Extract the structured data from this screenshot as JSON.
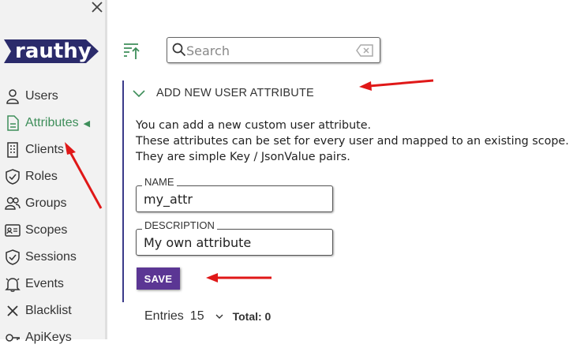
{
  "sidebar": {
    "logo_text": "rauthy",
    "close_icon": "close-icon",
    "items": [
      {
        "label": "Users",
        "icon": "user-icon"
      },
      {
        "label": "Attributes",
        "icon": "document-icon",
        "active": true
      },
      {
        "label": "Clients",
        "icon": "building-icon"
      },
      {
        "label": "Roles",
        "icon": "shield-check-icon"
      },
      {
        "label": "Groups",
        "icon": "users-group-icon"
      },
      {
        "label": "Scopes",
        "icon": "id-card-icon"
      },
      {
        "label": "Sessions",
        "icon": "shield-check-icon"
      },
      {
        "label": "Events",
        "icon": "bell-icon"
      },
      {
        "label": "Blacklist",
        "icon": "x-icon"
      },
      {
        "label": "ApiKeys",
        "icon": "key-icon"
      }
    ],
    "active_color": "#3e8e5a"
  },
  "toolbar": {
    "sort_icon": "sort-icon",
    "search_placeholder": "Search",
    "search_value": ""
  },
  "panel": {
    "title": "ADD NEW USER ATTRIBUTE",
    "description_lines": [
      "You can add a new custom user attribute.",
      "These attributes can be set for every user and mapped to an existing scope.",
      "They are simple Key / JsonValue pairs."
    ],
    "name_label": "NAME",
    "name_value": "my_attr",
    "description_label": "DESCRIPTION",
    "description_value": "My own attribute",
    "save_label": "SAVE",
    "accent_color": "#5b3694"
  },
  "footer": {
    "entries_label": "Entries",
    "entries_value": "15",
    "total_label": "Total: 0"
  },
  "annotation_color": "#e01818"
}
